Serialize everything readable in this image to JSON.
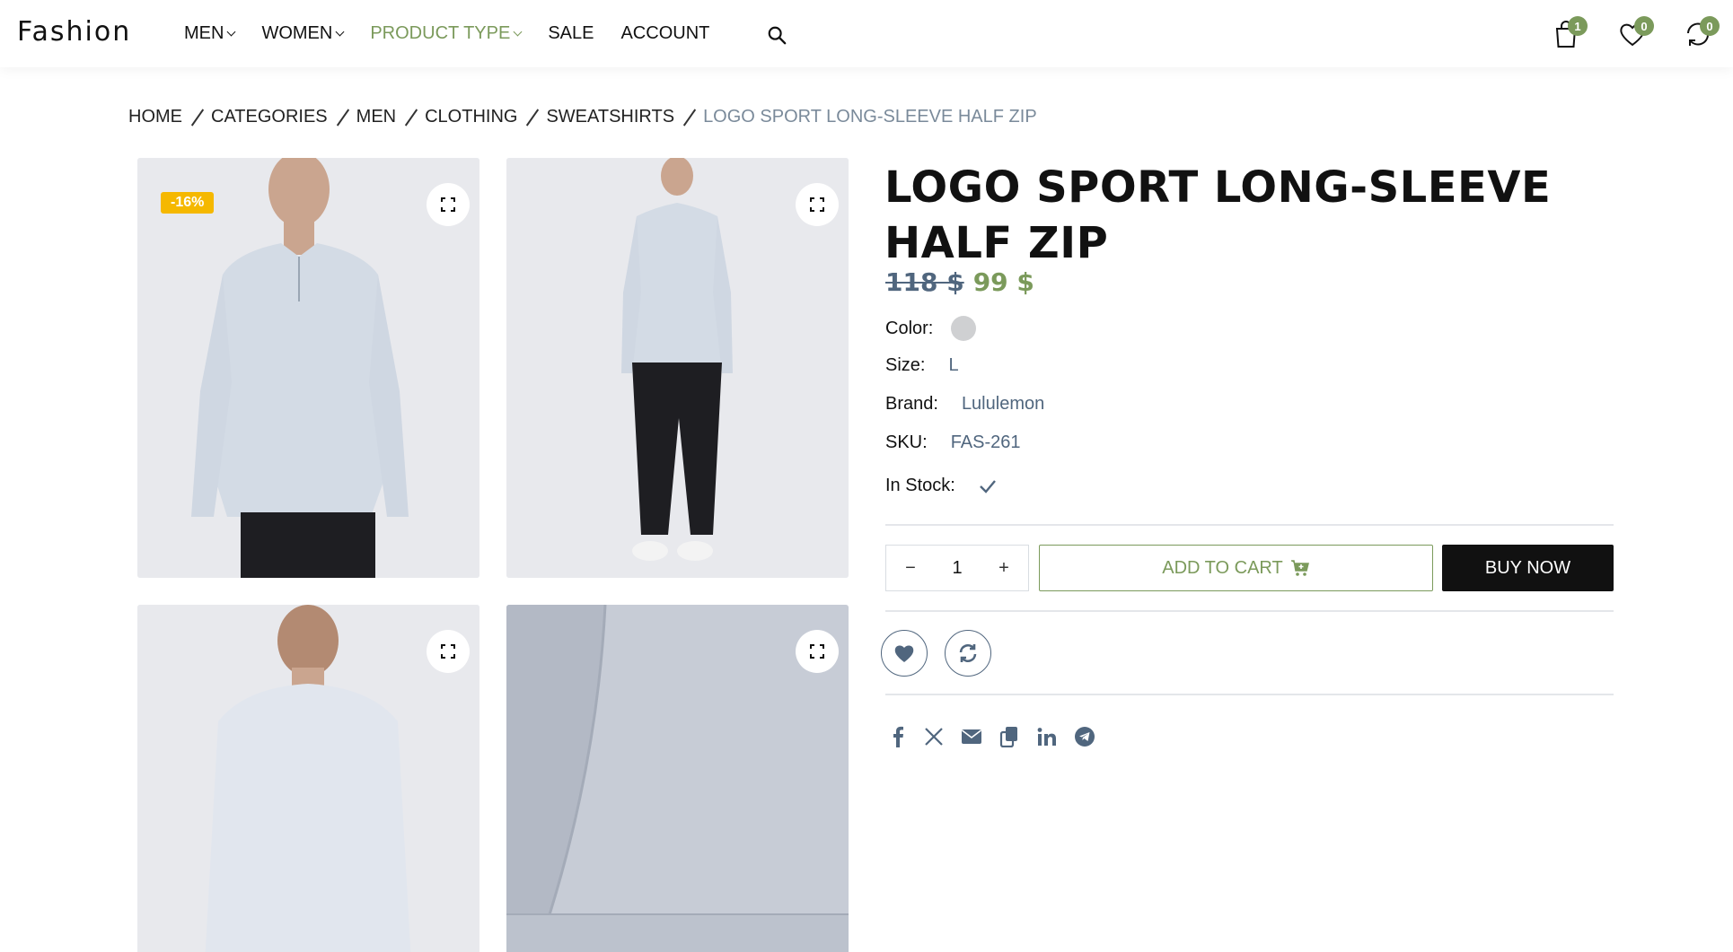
{
  "header": {
    "logo": "Fashion",
    "nav": [
      {
        "label": "MEN",
        "has_dropdown": true,
        "active": false
      },
      {
        "label": "WOMEN",
        "has_dropdown": true,
        "active": false
      },
      {
        "label": "PRODUCT TYPE",
        "has_dropdown": true,
        "active": true
      },
      {
        "label": "SALE",
        "has_dropdown": false,
        "active": false
      },
      {
        "label": "ACCOUNT",
        "has_dropdown": false,
        "active": false
      }
    ],
    "cart_count": "1",
    "wishlist_count": "0",
    "compare_count": "0"
  },
  "breadcrumb": [
    "HOME",
    "CATEGORIES",
    "MEN",
    "CLOTHING",
    "SWEATSHIRTS",
    "LOGO SPORT LONG-SLEEVE HALF ZIP"
  ],
  "gallery": {
    "discount_badge": "-16%",
    "images": [
      "front-view",
      "full-body-view",
      "back-view",
      "fabric-detail"
    ]
  },
  "product": {
    "title": "LOGO SPORT LONG-SLEEVE HALF ZIP",
    "old_price": "118 $",
    "new_price": "99 $",
    "color_label": "Color:",
    "color_value": "#cfd0d2",
    "size_label": "Size:",
    "size_value": "L",
    "brand_label": "Brand:",
    "brand_value": "Lululemon",
    "sku_label": "SKU:",
    "sku_value": "FAS-261",
    "stock_label": "In Stock:",
    "quantity": "1",
    "add_to_cart_label": "ADD TO CART",
    "buy_now_label": "BUY NOW"
  },
  "share": [
    "facebook-icon",
    "x-icon",
    "email-icon",
    "copy-icon",
    "linkedin-icon",
    "telegram-icon"
  ],
  "colors": {
    "accent": "#7b9a5b",
    "muted": "#50667e",
    "badge": "#f5b800"
  }
}
